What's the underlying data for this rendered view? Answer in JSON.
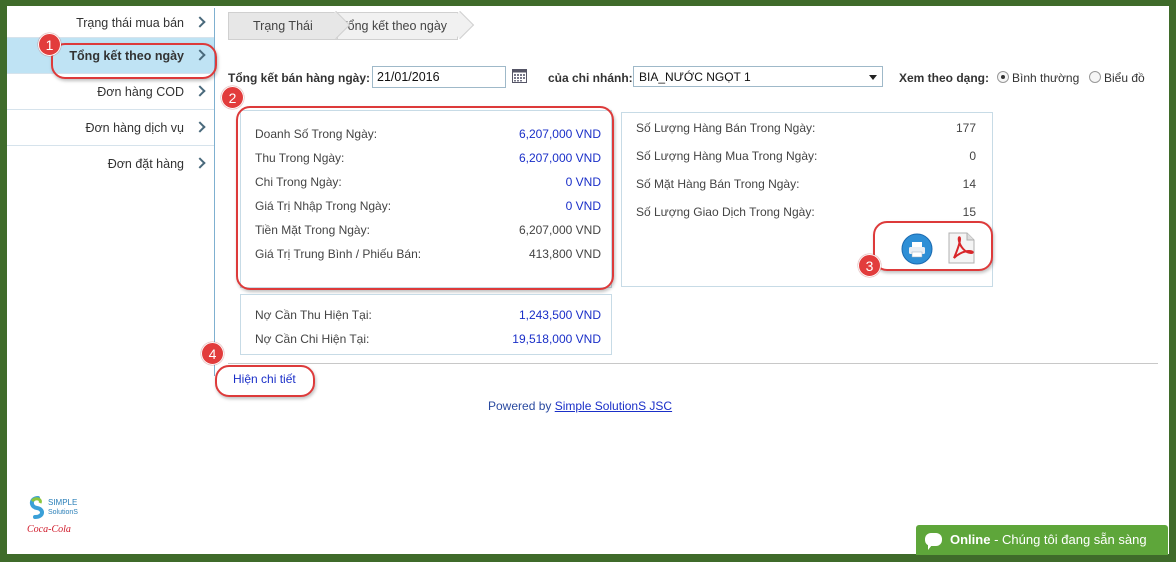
{
  "sidebar": {
    "items": [
      {
        "label": "Trạng thái mua bán"
      },
      {
        "label": "Tổng kết theo ngày"
      },
      {
        "label": "Đơn hàng COD"
      },
      {
        "label": "Đơn hàng dịch vụ"
      },
      {
        "label": "Đơn đặt hàng"
      }
    ],
    "logo_line1": "SIMPLE",
    "logo_line2": "SolutionS",
    "logo_brand": "Coca-Cola"
  },
  "breadcrumb": {
    "items": [
      "Trạng Thái",
      "Tổng kết theo ngày"
    ]
  },
  "filter": {
    "date_label": "Tổng kết bán hàng ngày:",
    "date_value": "21/01/2016",
    "branch_label": "của chi nhánh:",
    "branch_value": "BIA_NƯỚC NGỌT 1",
    "view_label": "Xem theo dạng:",
    "view_options": [
      "Bình thường",
      "Biểu đồ"
    ],
    "view_selected": "Bình thường"
  },
  "summary": {
    "rows": [
      {
        "label": "Doanh Số Trong Ngày:",
        "value": "6,207,000 VND"
      },
      {
        "label": "Thu Trong Ngày:",
        "value": "6,207,000 VND"
      },
      {
        "label": "Chi Trong Ngày:",
        "value": "0 VND"
      },
      {
        "label": "Giá Trị Nhập Trong Ngày:",
        "value": "0 VND"
      },
      {
        "label": "Tiền Mặt Trong Ngày:",
        "value": "6,207,000 VND"
      },
      {
        "label": "Giá Trị Trung Bình / Phiếu Bán:",
        "value": "413,800 VND"
      }
    ]
  },
  "debt": {
    "rows": [
      {
        "label": "Nợ Cần Thu Hiện Tại:",
        "value": "1,243,500 VND"
      },
      {
        "label": "Nợ Cần Chi Hiện Tại:",
        "value": "19,518,000 VND"
      }
    ]
  },
  "quantity": {
    "rows": [
      {
        "label": "Số Lượng Hàng Bán Trong Ngày:",
        "value": "177"
      },
      {
        "label": "Số Lượng Hàng Mua Trong Ngày:",
        "value": "0"
      },
      {
        "label": "Số Mặt Hàng Bán Trong Ngày:",
        "value": "14"
      },
      {
        "label": "Số Lượng Giao Dịch Trong Ngày:",
        "value": "15"
      }
    ]
  },
  "badges": [
    "1",
    "2",
    "3",
    "4"
  ],
  "detail_link": "Hiện chi tiết",
  "footer": {
    "powered_prefix": "Powered by ",
    "powered_link": "Simple SolutionS JSC"
  },
  "chat": {
    "status": "Online",
    "message": " - Chúng tôi đang sẵn sàng"
  },
  "colors": {
    "accent_blue": "#1a2fc8",
    "active_bg": "#bfe3f4",
    "highlight_red": "#dd3a3a",
    "chat_green": "#5ea63a",
    "frame_green": "#3f6b2a"
  }
}
